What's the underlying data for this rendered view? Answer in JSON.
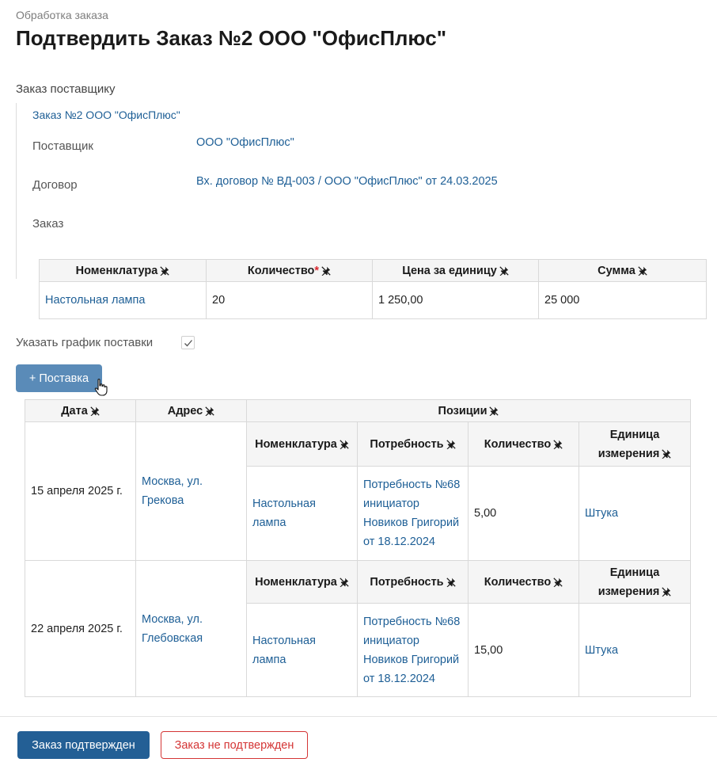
{
  "header": {
    "breadcrumb": "Обработка заказа",
    "title": "Подтвердить Заказ №2 ООО \"ОфисПлюс\""
  },
  "order": {
    "section_title": "Заказ поставщику",
    "link": "Заказ №2 ООО \"ОфисПлюс\"",
    "supplier_label": "Поставщик",
    "supplier_value": "ООО \"ОфисПлюс\"",
    "contract_label": "Договор",
    "contract_value": "Вх. договор № ВД-003 / ООО \"ОфисПлюс\" от 24.03.2025",
    "order_label": "Заказ",
    "table": {
      "headers": [
        "Номенклатура",
        "Количество",
        "Цена за единицу",
        "Сумма"
      ],
      "rows": [
        {
          "item": "Настольная лампа",
          "qty": "20",
          "price": "1 250,00",
          "sum": "25 000"
        }
      ]
    }
  },
  "schedule": {
    "label": "Указать график поставки",
    "checked": true,
    "add_button": "+ Поставка"
  },
  "delivery": {
    "headers": {
      "date": "Дата",
      "address": "Адрес",
      "positions": "Позиции"
    },
    "sub_headers": [
      "Номенклатура",
      "Потребность",
      "Количество",
      "Единица измерения"
    ],
    "rows": [
      {
        "date": "15 апреля 2025 г.",
        "address": "Москва, ул. Грекова",
        "item": "Настольная лампа",
        "need": "Потребность №68 инициатор Новиков Григорий от 18.12.2024",
        "qty": "5,00",
        "unit": "Штука"
      },
      {
        "date": "22 апреля 2025 г.",
        "address": "Москва, ул. Глебовская",
        "item": "Настольная лампа",
        "need": "Потребность №68 инициатор Новиков Григорий от 18.12.2024",
        "qty": "15,00",
        "unit": "Штука"
      }
    ]
  },
  "footer": {
    "confirm": "Заказ подтвержден",
    "reject": "Заказ не подтвержден"
  },
  "colors": {
    "link": "#1e5f96",
    "primary_button": "#235f95",
    "secondary_button": "#5a8bb8",
    "danger": "#d43535",
    "required": "#d9272e"
  },
  "icons": {
    "column_pin": "pin-icon",
    "checkbox": "checkmark-icon",
    "cursor": "hand-cursor-icon"
  }
}
